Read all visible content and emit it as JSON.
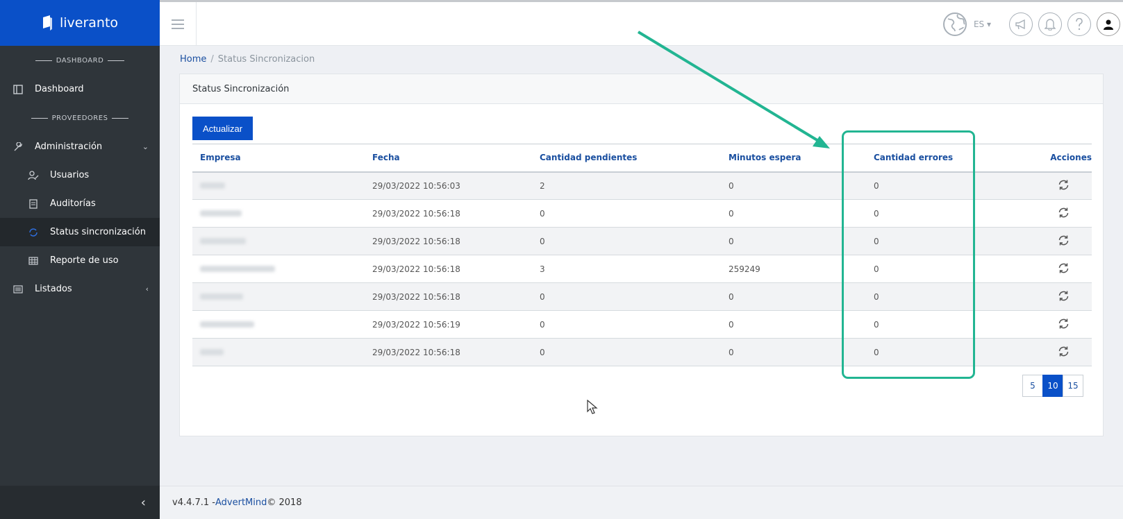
{
  "brand": {
    "name": "liveranto"
  },
  "sidebar": {
    "section_dashboard": "DASHBOARD",
    "section_providers": "PROVEEDORES",
    "items": [
      {
        "label": "Dashboard",
        "icon": "layout-icon"
      },
      {
        "label": "Administración",
        "icon": "wrench-icon"
      },
      {
        "label": "Usuarios",
        "icon": "user-edit-icon"
      },
      {
        "label": "Auditorías",
        "icon": "clipboard-icon"
      },
      {
        "label": "Status sincronización",
        "icon": "sync-icon"
      },
      {
        "label": "Reporte de uso",
        "icon": "table-icon"
      },
      {
        "label": "Listados",
        "icon": "list-icon"
      }
    ]
  },
  "header": {
    "lang": "ES"
  },
  "breadcrumb": {
    "home": "Home",
    "current": "Status Sincronizacion"
  },
  "card": {
    "title": "Status Sincronización",
    "refresh_label": "Actualizar"
  },
  "table": {
    "headers": [
      "Empresa",
      "Fecha",
      "Cantidad pendientes",
      "Minutos espera",
      "Cantidad errores",
      "Acciones"
    ],
    "rows": [
      {
        "fecha": "29/03/2022 10:56:03",
        "pendientes": "2",
        "minutos": "0",
        "errores": "0"
      },
      {
        "fecha": "29/03/2022 10:56:18",
        "pendientes": "0",
        "minutos": "0",
        "errores": "0"
      },
      {
        "fecha": "29/03/2022 10:56:18",
        "pendientes": "0",
        "minutos": "0",
        "errores": "0"
      },
      {
        "fecha": "29/03/2022 10:56:18",
        "pendientes": "3",
        "minutos": "259249",
        "errores": "0"
      },
      {
        "fecha": "29/03/2022 10:56:18",
        "pendientes": "0",
        "minutos": "0",
        "errores": "0"
      },
      {
        "fecha": "29/03/2022 10:56:19",
        "pendientes": "0",
        "minutos": "0",
        "errores": "0"
      },
      {
        "fecha": "29/03/2022 10:56:18",
        "pendientes": "0",
        "minutos": "0",
        "errores": "0"
      }
    ]
  },
  "pager": {
    "sizes": [
      "5",
      "10",
      "15"
    ],
    "active": "10"
  },
  "footer": {
    "version": "v4.4.7.1 - ",
    "company": "AdvertMind",
    "copyright": " © 2018"
  },
  "colors": {
    "brand": "#0a50c8",
    "sidebar": "#2f353a",
    "annotation": "#22b592"
  }
}
